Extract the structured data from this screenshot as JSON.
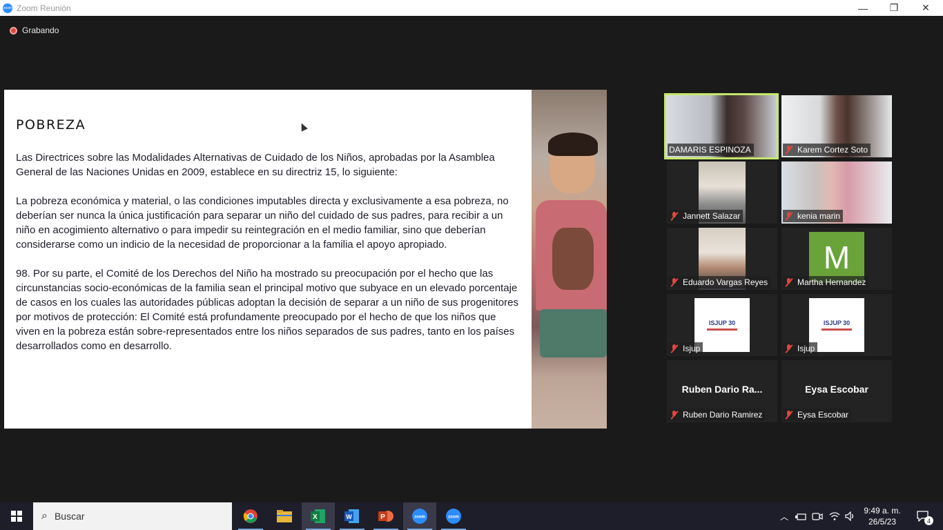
{
  "window": {
    "title": "Zoom Reunión",
    "minimize": "—",
    "restore": "❐",
    "close": "✕"
  },
  "recording": {
    "label": "Grabando"
  },
  "slide": {
    "heading": "POBREZA",
    "paragraphs": [
      "Las Directrices sobre las Modalidades Alternativas de Cuidado de los Niños, aprobadas por la Asamblea General de las Naciones Unidas en 2009, establece en su directriz 15, lo siguiente:",
      "La pobreza económica y material, o las condiciones imputables directa y exclusivamente a esa pobreza, no deberían ser nunca la única justificación para separar un niño del cuidado de sus padres, para recibir a un niño en acogimiento alternativo o para impedir su reintegración en el medio familiar, sino que deberían considerarse como un indicio de la necesidad de proporcionar a la familia el apoyo apropiado.",
      "98. Por su parte, el Comité de los Derechos del Niño ha mostrado su preocupación por el hecho que las circunstancias socio-económicas de la familia sean el principal motivo que subyace en un elevado porcentaje de casos en los cuales las autoridades públicas adoptan la decisión de separar a un niño de sus progenitores por motivos de protección:  El Comité está profundamente preocupado por el hecho de que los niños que viven en la pobreza están sobre-representados entre los niños separados de sus padres, tanto en los países desarrollados como en desarrollo."
    ]
  },
  "participants": [
    {
      "name": "DAMARIS ESPINOZA",
      "muted": false,
      "active": true,
      "kind": "video"
    },
    {
      "name": "Karem Cortez Soto",
      "muted": true,
      "active": false,
      "kind": "video"
    },
    {
      "name": "Jannett Salazar",
      "muted": true,
      "active": false,
      "kind": "video"
    },
    {
      "name": "kenia marin",
      "muted": true,
      "active": false,
      "kind": "video"
    },
    {
      "name": "Eduardo Vargas Reyes",
      "muted": true,
      "active": false,
      "kind": "video"
    },
    {
      "name": "Martha Hernandez",
      "muted": true,
      "active": false,
      "kind": "avatar",
      "initial": "M"
    },
    {
      "name": "Isjup",
      "muted": true,
      "active": false,
      "kind": "logo",
      "logo_text": "ISJUP 30"
    },
    {
      "name": "Isjup",
      "muted": true,
      "active": false,
      "kind": "logo",
      "logo_text": "ISJUP 30"
    },
    {
      "name": "Ruben Dario Ramirez",
      "display": "Ruben Dario Ra...",
      "muted": true,
      "active": false,
      "kind": "name"
    },
    {
      "name": "Eysa Escobar",
      "display": "Eysa Escobar",
      "muted": true,
      "active": false,
      "kind": "name"
    }
  ],
  "taskbar": {
    "search_placeholder": "Buscar",
    "apps": [
      "chrome-icon",
      "file-explorer-icon",
      "excel-icon",
      "word-icon",
      "powerpoint-icon",
      "zoom-icon",
      "zoom-icon"
    ],
    "time": "9:49 a. m.",
    "date": "26/5/23",
    "notifications": "4"
  },
  "colors": {
    "accent_active": "#c5e86c",
    "muted_red": "#e0473e",
    "avatar_green": "#6aa33a",
    "zoom_blue": "#2d8cff"
  }
}
